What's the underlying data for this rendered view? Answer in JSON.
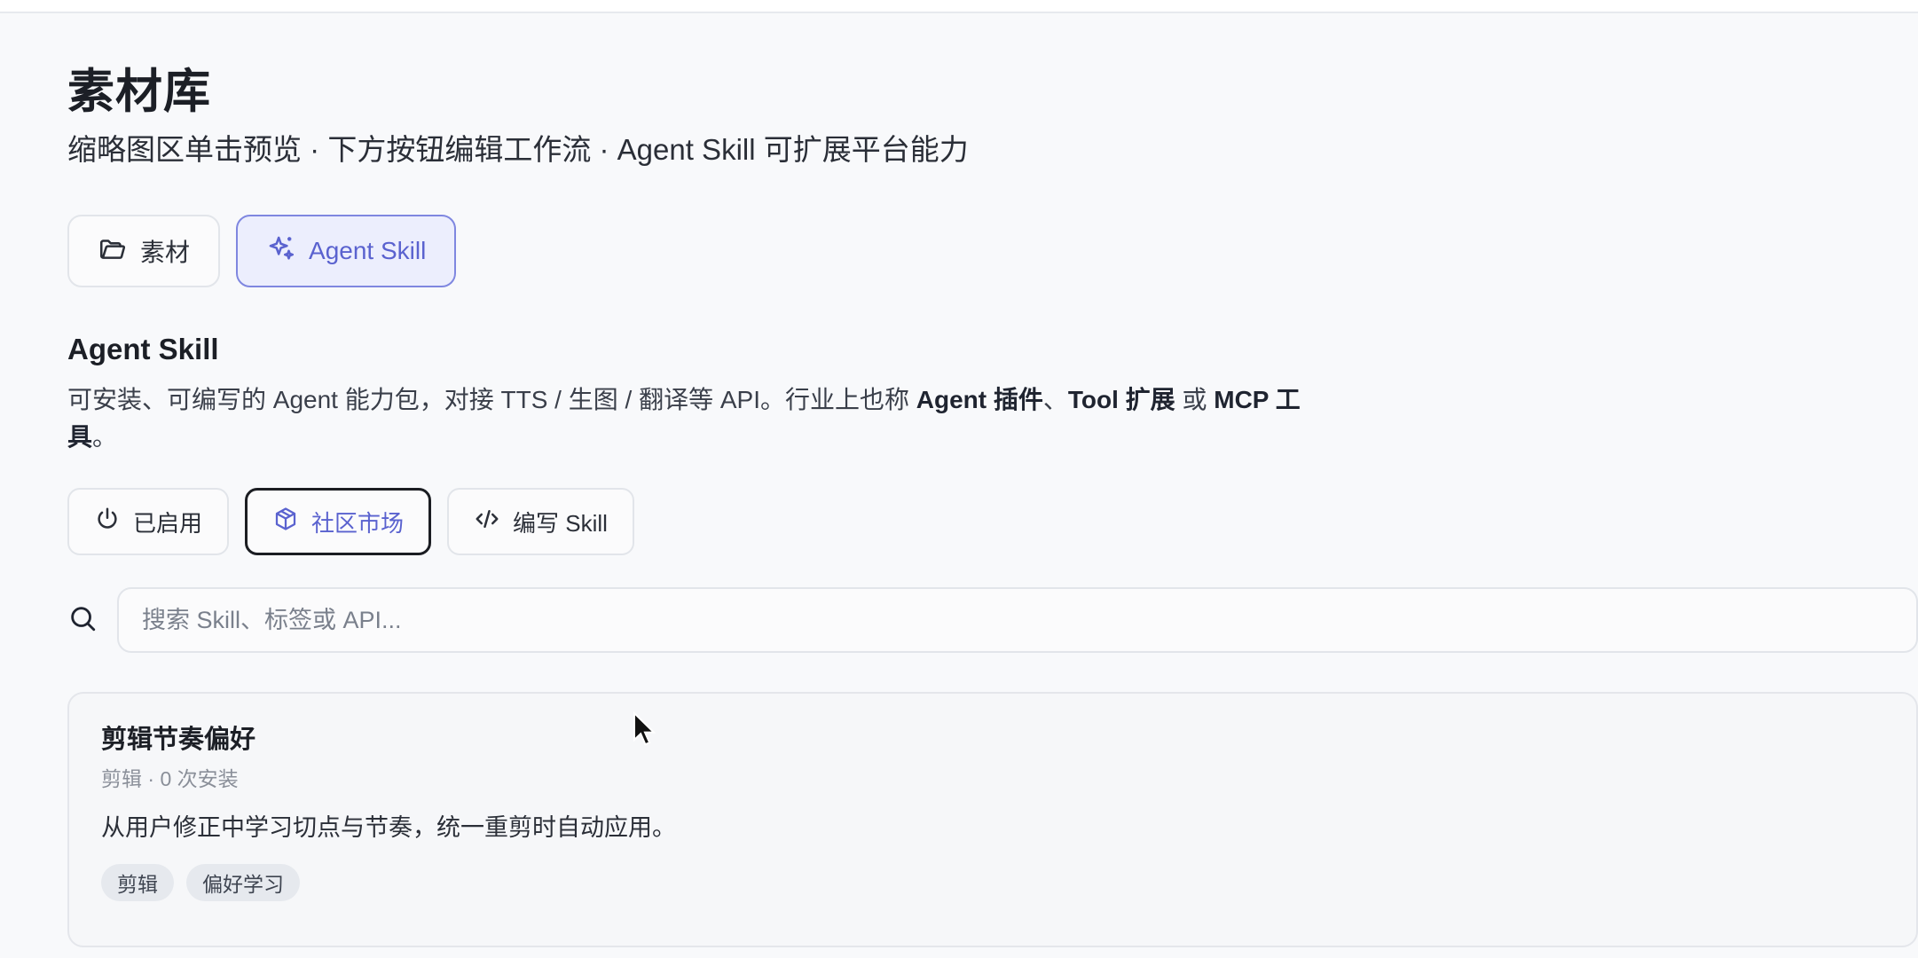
{
  "header": {
    "title": "素材库",
    "subtitle": "缩略图区单击预览 · 下方按钮编辑工作流 · Agent Skill 可扩展平台能力"
  },
  "tabs": [
    {
      "label": "素材",
      "icon": "folder-open-icon",
      "active": false
    },
    {
      "label": "Agent Skill",
      "icon": "sparkles-icon",
      "active": true
    }
  ],
  "section": {
    "title": "Agent Skill",
    "desc_prefix": "可安装、可编写的 Agent 能力包，对接 TTS / 生图 / 翻译等 API。行业上也称 ",
    "desc_bold_1": "Agent 插件",
    "desc_sep_1": "、",
    "desc_bold_2": "Tool 扩展",
    "desc_sep_2": " 或 ",
    "desc_bold_3": "MCP 工具",
    "desc_suffix": "。"
  },
  "subtabs": [
    {
      "label": "已启用",
      "icon": "power-icon",
      "active": false
    },
    {
      "label": "社区市场",
      "icon": "package-icon",
      "active": true
    },
    {
      "label": "编写 Skill",
      "icon": "code-icon",
      "active": false
    }
  ],
  "search": {
    "placeholder": "搜索 Skill、标签或 API..."
  },
  "skill_card": {
    "title": "剪辑节奏偏好",
    "meta": "剪辑 · 0 次安装",
    "description": "从用户修正中学习切点与节奏，统一重剪时自动应用。",
    "tags": [
      "剪辑",
      "偏好学习"
    ]
  },
  "colors": {
    "accent": "#5a62cf",
    "accent_bg": "#eceefd",
    "border": "#e2e5ea",
    "page_bg": "#f8f9fb"
  }
}
